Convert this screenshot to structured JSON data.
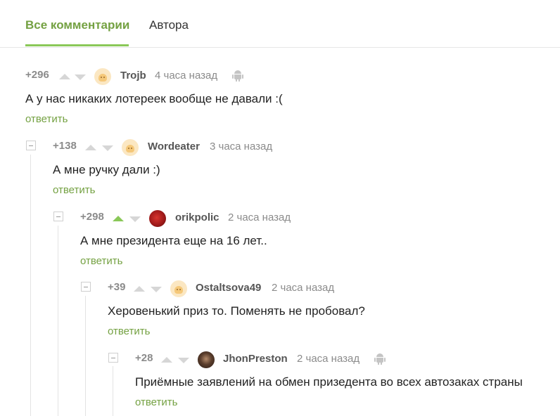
{
  "tabs": [
    {
      "label": "Все комментарии",
      "active": true
    },
    {
      "label": "Автора",
      "active": false
    }
  ],
  "comments": [
    {
      "rating": "+296",
      "username": "Trojb",
      "time": "4 часа назад",
      "text": "А у нас никаких лотереек вообще не давали :(",
      "reply": "ответить",
      "avatar": "default-avatar-icon",
      "android": true,
      "upvoted": false
    },
    {
      "rating": "+138",
      "username": "Wordeater",
      "time": "3 часа назад",
      "text": "А мне ручку дали :)",
      "reply": "ответить",
      "avatar": "default-avatar-icon",
      "android": false,
      "upvoted": false
    },
    {
      "rating": "+298",
      "username": "orikpolic",
      "time": "2 часа назад",
      "text": "А мне президента еще на 16 лет..",
      "reply": "ответить",
      "avatar": "red-avatar-icon",
      "android": false,
      "upvoted": true
    },
    {
      "rating": "+39",
      "username": "Ostaltsova49",
      "time": "2 часа назад",
      "text": "Херовенький приз то. Поменять не пробовал?",
      "reply": "ответить",
      "avatar": "default-avatar-icon",
      "android": false,
      "upvoted": false
    },
    {
      "rating": "+28",
      "username": "JhonPreston",
      "time": "2 часа назад",
      "text": "Приёмные заявлений на обмен призедента во всех автозаках страны",
      "reply": "ответить",
      "avatar": "photo-avatar-icon",
      "android": true,
      "upvoted": false
    }
  ],
  "colors": {
    "accent": "#74a142",
    "upvote_active": "#8ac858",
    "muted": "#8b8b8b"
  }
}
